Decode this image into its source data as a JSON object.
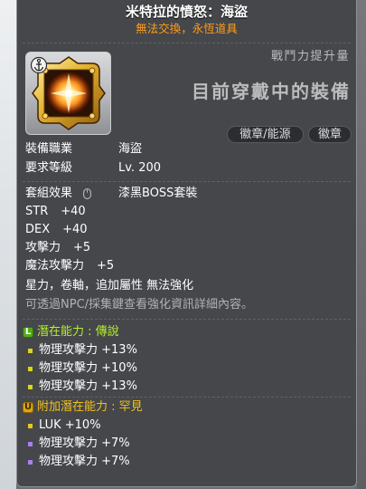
{
  "item": {
    "name": "米特拉的憤怒：海盜",
    "trade_note": "無法交換，永恆道具"
  },
  "compare": {
    "combat_power_label": "戰鬥力提升量",
    "equipped_label": "目前穿戴中的裝備",
    "slot_tags": [
      "徽章/能源",
      "徽章"
    ]
  },
  "requirements": {
    "job_label": "裝備職業",
    "job_value": "海盜",
    "level_label": "要求等級",
    "level_value": "Lv. 200"
  },
  "set_effect": {
    "label": "套組效果",
    "value": "漆黑BOSS套裝"
  },
  "stats": [
    {
      "label": "STR",
      "value": "+40"
    },
    {
      "label": "DEX",
      "value": "+40"
    },
    {
      "label": "攻擊力",
      "value": "+5"
    },
    {
      "label": "魔法攻擊力",
      "value": "+5"
    }
  ],
  "notes": {
    "enhance_restriction": "星力，卷軸，追加屬性 無法強化",
    "enhance_hint": "可透過NPC/採集鍵查看強化資訊詳細內容。"
  },
  "potential": {
    "grade_badge": "L",
    "title": "潛在能力 : 傳說",
    "lines": [
      {
        "text": "物理攻擊力 +13%",
        "bullet_color": "#d9d41c"
      },
      {
        "text": "物理攻擊力 +10%",
        "bullet_color": "#d9d41c"
      },
      {
        "text": "物理攻擊力 +13%",
        "bullet_color": "#d9d41c"
      }
    ]
  },
  "additional_potential": {
    "grade_badge": "U",
    "title": "附加潛在能力 : 罕見",
    "lines": [
      {
        "text": "LUK +10%",
        "bullet_color": "#e8c81a"
      },
      {
        "text": "物理攻擊力 +7%",
        "bullet_color": "#b07cf2"
      },
      {
        "text": "物理攻擊力 +7%",
        "bullet_color": "#b07cf2"
      }
    ]
  },
  "icons": {
    "item": "pirate-emblem-icon",
    "badge": "anchor-icon",
    "set_effect": "mouse-icon",
    "potential_grade": "legendary-grade-icon",
    "additional_grade": "unique-grade-icon"
  },
  "colors": {
    "tooltip_bg": "#45474b",
    "tooltip_border": "#8e9094",
    "title": "#ffffff",
    "subtitle": "#ff9c1a",
    "text": "#ffffff",
    "muted": "#b2b2b2",
    "header_gray": "#bcbcbc",
    "legendary": "#b6f02a",
    "unique": "#f2c21c",
    "legendary_badge": "#4fae16",
    "unique_badge": "#e0a40c",
    "tag_bg": "#2b2d31"
  }
}
